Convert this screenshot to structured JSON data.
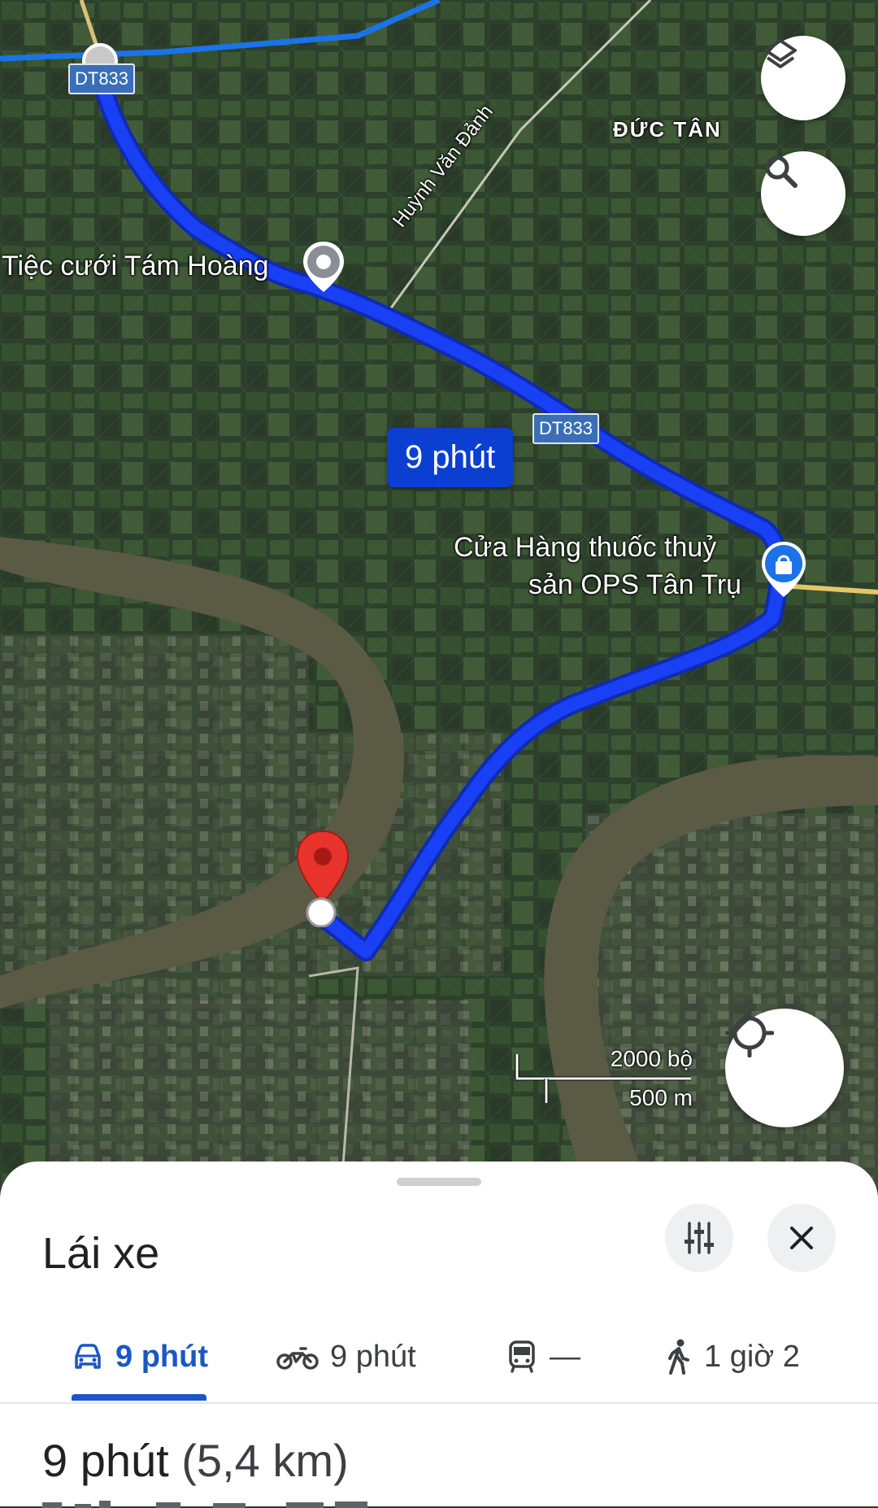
{
  "map": {
    "area_label": "ĐỨC TÂN",
    "road_name": "Huỳnh Văn Đảnh",
    "road_shield_top": "DT833",
    "road_shield_mid": "DT833",
    "route_time_badge": "9 phút",
    "poi_wedding": "Tiệc cưới Tám Hoàng",
    "poi_shop_line1": "Cửa Hàng thuốc thuỷ",
    "poi_shop_line2": "sản OPS Tân Trụ",
    "scale_feet": "2000 bộ",
    "scale_meters": "500 m",
    "route_color": "#1a40f5"
  },
  "controls": {
    "layers_icon": "layers-icon",
    "search_icon": "search-icon",
    "locate_icon": "my-location-icon"
  },
  "sheet": {
    "title": "Lái xe",
    "options_icon": "sliders-icon",
    "close_icon": "close-icon",
    "modes": [
      {
        "icon": "car-icon",
        "label": "9 phút"
      },
      {
        "icon": "motorbike-icon",
        "label": "9 phút"
      },
      {
        "icon": "transit-icon",
        "label": "—"
      },
      {
        "icon": "walk-icon",
        "label": "1 giờ 2"
      }
    ],
    "summary_time": "9 phút",
    "summary_distance": "(5,4 km)",
    "accent": "#1a57c4"
  }
}
